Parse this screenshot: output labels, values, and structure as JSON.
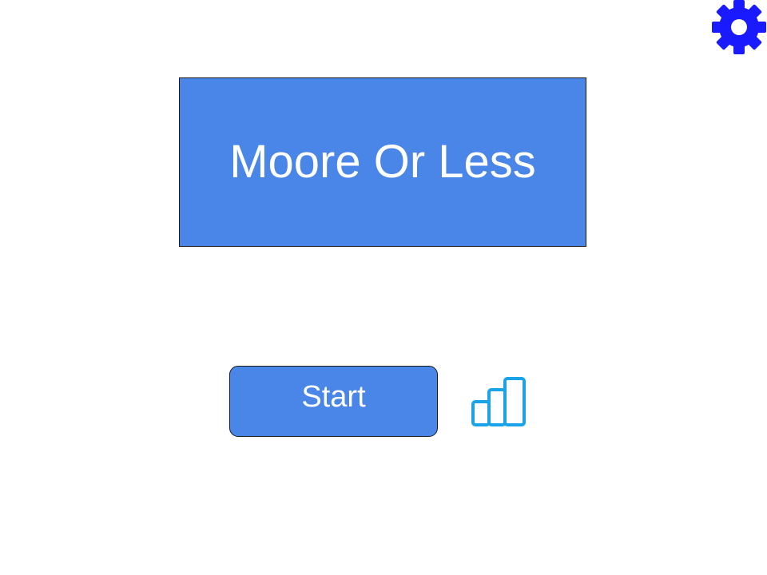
{
  "game": {
    "title": "Moore Or Less"
  },
  "menu": {
    "start_label": "Start"
  },
  "icons": {
    "settings": "gear-icon",
    "leaderboard": "bar-chart-icon"
  },
  "colors": {
    "button_fill": "#4a86e8",
    "button_text": "#ffffff",
    "gear": "#1a1aff",
    "stats_icon": "#1aa3e8",
    "border": "#1a1a1a",
    "background": "#ffffff"
  }
}
